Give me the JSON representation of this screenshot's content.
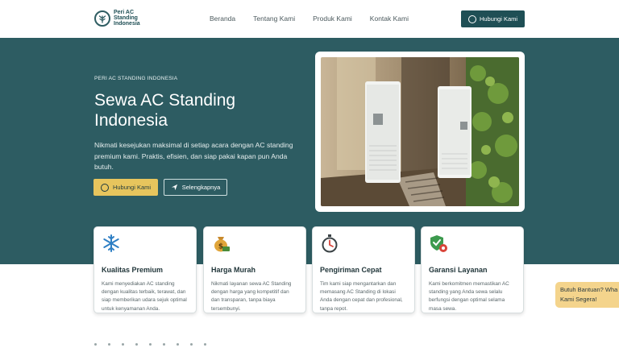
{
  "nav": {
    "logo": "Peri AC Standing Indonesia",
    "links": [
      "Beranda",
      "Tentang Kami",
      "Produk Kami",
      "Kontak Kami"
    ],
    "cta": "Hubungi Kami"
  },
  "hero": {
    "eyebrow": "PERI AC STANDING INDONESIA",
    "title": "Sewa AC Standing Indonesia",
    "description": "Nikmati kesejukan maksimal di setiap acara dengan AC standing premium kami. Praktis, efisien, dan siap pakai kapan pun Anda butuh.",
    "primary_button": "Hubungi Kami",
    "secondary_button": "Selengkapnya"
  },
  "features": [
    {
      "title": "Kualitas Premium",
      "text": "Kami menyediakan AC standing dengan kualitas terbaik, terawat, dan siap memberikan udara sejuk optimal untuk kenyamanan Anda.",
      "icon": "snowflake-icon"
    },
    {
      "title": "Harga Murah",
      "text": "Nikmati layanan sewa AC Standing dengan harga yang kompetitif dan dan transparan, tanpa biaya tersembunyi.",
      "icon": "money-bag-icon"
    },
    {
      "title": "Pengiriman Cepat",
      "text": "Tim kami siap mengantarkan dan memasang AC Standing di lokasi Anda dengan cepat dan profesional, tanpa repot.",
      "icon": "stopwatch-icon"
    },
    {
      "title": "Garansi Layanan",
      "text": "Kami berkomitmen memastikan AC standing yang Anda sewa selalu berfungsi dengan optimal selama masa sewa.",
      "icon": "shield-check-icon"
    }
  ],
  "help_widget": "Butuh Bantuan? Wha Kami Segera!",
  "colors": {
    "primary": "#2d5c62",
    "accent": "#e7c55d",
    "nav_cta": "#1f4f55"
  }
}
